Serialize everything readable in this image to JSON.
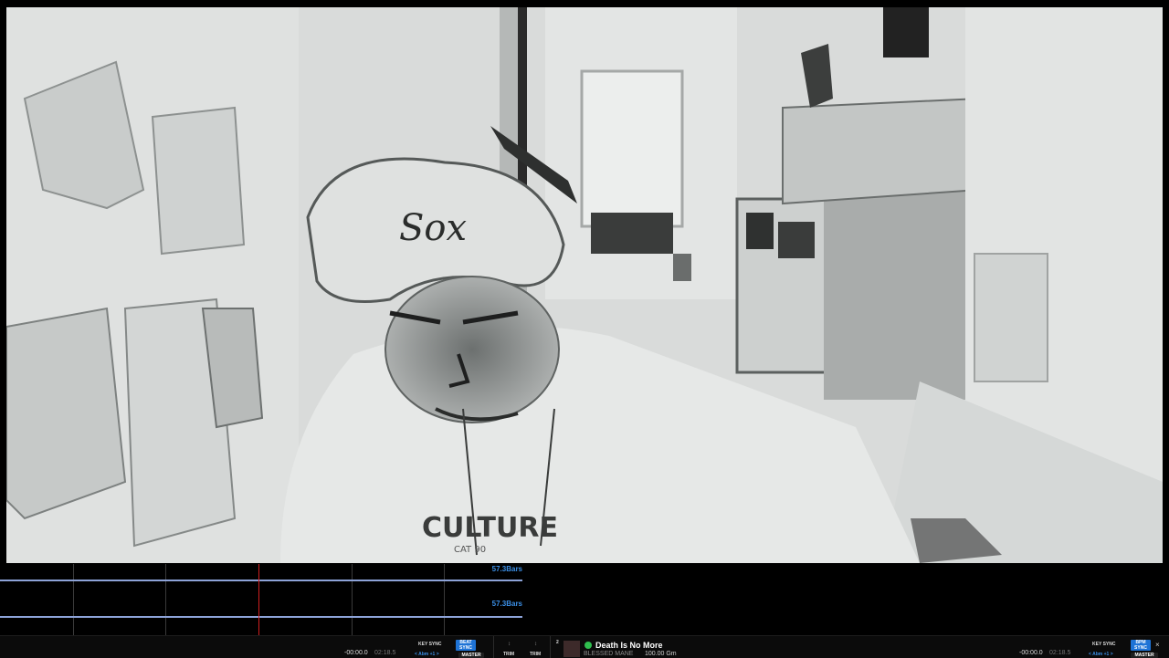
{
  "video": {
    "cap_logo": "Sox",
    "shirt_text": "CULTURE",
    "shirt_subtext": "CAT 90"
  },
  "waveform": {
    "bars_top": "57.3Bars",
    "bars_bottom": "57.3Bars"
  },
  "deck1": {
    "time_remaining": "-00:00.0",
    "time_total": "02:18.5",
    "key_sync": "KEY SYNC",
    "beat_sync": "BEAT SYNC",
    "master": "MASTER",
    "key_shift": "< Abm +1 >",
    "trim1": "TRIM",
    "trim2": "TRIM"
  },
  "deck2": {
    "number": "2",
    "title": "Death Is No More",
    "artist": "BLESSED MANE",
    "bpm": "100.00 Gm",
    "time_remaining": "-00:00.0",
    "time_total": "02:18.5",
    "key_sync": "KEY SYNC",
    "bpm_sync": "BPM SYNC",
    "master": "MASTER",
    "key_shift": "< Abm +1 >",
    "close": "×"
  },
  "colors": {
    "accent": "#1e73d6",
    "beatgrid": "#8da3d8",
    "playhead": "#d02020",
    "status_green": "#2fbf4f"
  }
}
